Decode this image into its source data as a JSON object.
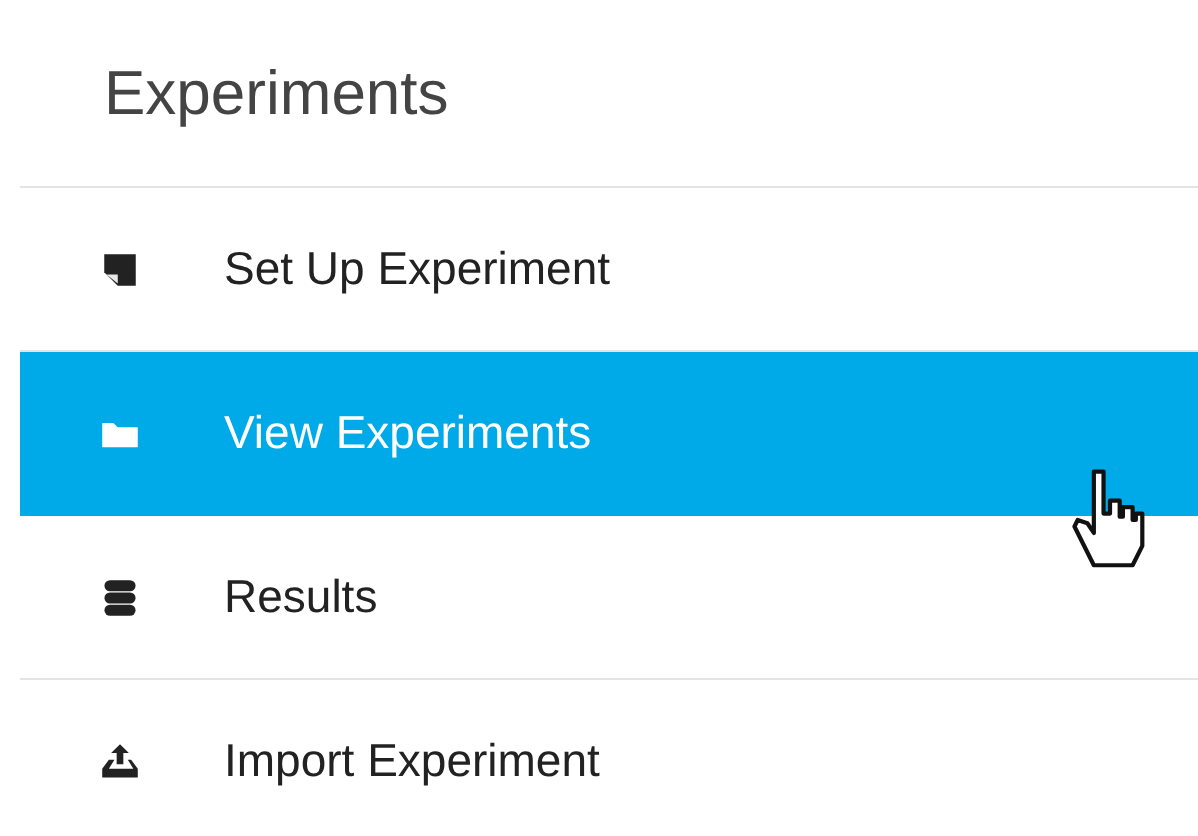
{
  "panel": {
    "title": "Experiments"
  },
  "items": [
    {
      "label": "Set Up Experiment",
      "selected": false
    },
    {
      "label": "View Experiments",
      "selected": true
    },
    {
      "label": "Results",
      "selected": false
    },
    {
      "label": "Import Experiment",
      "selected": false
    }
  ]
}
